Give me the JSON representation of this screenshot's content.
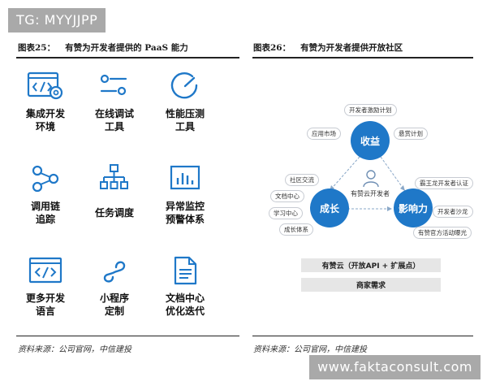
{
  "watermark_top": "TG: MYYJJPP",
  "watermark_bottom": "www.faktaconsult.com",
  "left_figure": {
    "number": "图表25：",
    "title": "有赞为开发者提供的 PaaS 能力",
    "source": "资料来源：公司官网，中信建投",
    "capabilities": [
      {
        "label": "集成开发\n环境",
        "icon": "ide-code-gear-icon"
      },
      {
        "label": "在线调试\n工具",
        "icon": "debug-toggle-icon"
      },
      {
        "label": "性能压测\n工具",
        "icon": "gauge-icon"
      },
      {
        "label": "调用链\n追踪",
        "icon": "share-nodes-icon"
      },
      {
        "label": "任务调度",
        "icon": "hierarchy-icon"
      },
      {
        "label": "异常监控\n预警体系",
        "icon": "bar-chart-monitor-icon"
      },
      {
        "label": "更多开发\n语言",
        "icon": "code-window-icon"
      },
      {
        "label": "小程序\n定制",
        "icon": "link-chain-icon"
      },
      {
        "label": "文档中心\n优化迭代",
        "icon": "document-icon"
      }
    ]
  },
  "right_figure": {
    "number": "图表26：",
    "title": "有赞为开发者提供开放社区",
    "source": "资料来源：公司官网，中信建投",
    "center_label": "有赞云开发者",
    "circles": {
      "top": "收益",
      "left": "成长",
      "right": "影响力"
    },
    "tags_top": [
      "开发者激励计划",
      "应用市场",
      "悬赏计划"
    ],
    "tags_left": [
      "社区交流",
      "文档中心",
      "学习中心",
      "成长体系"
    ],
    "tags_right": [
      "霸王龙开发者认证",
      "开发者沙龙",
      "有赞官方活动曝光"
    ],
    "bar_1": "有赞云（开放API + 扩展点）",
    "bar_2": "商家需求",
    "accent_color": "#1f78c8"
  }
}
